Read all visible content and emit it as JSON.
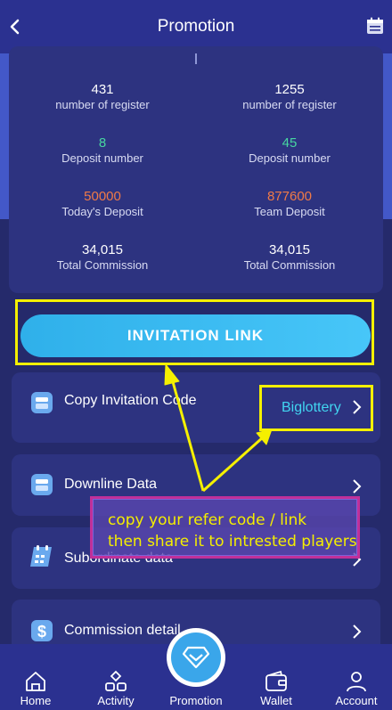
{
  "header": {
    "title": "Promotion"
  },
  "stats": {
    "left": [
      {
        "value": "431",
        "label": "number of register"
      },
      {
        "value": "8",
        "label": "Deposit number"
      },
      {
        "value": "50000",
        "label": "Today's Deposit"
      },
      {
        "value": "34,015",
        "label": "Total Commission"
      }
    ],
    "right": [
      {
        "value": "1255",
        "label": "number of register"
      },
      {
        "value": "45",
        "label": "Deposit number"
      },
      {
        "value": "877600",
        "label": "Team Deposit"
      },
      {
        "value": "34,015",
        "label": "Total Commission"
      }
    ]
  },
  "invite": {
    "label": "INVITATION LINK"
  },
  "rows": {
    "copy_code": {
      "label": "Copy Invitation Code",
      "value": "Biglottery"
    },
    "downline": {
      "label": "Downline Data"
    },
    "subordinate": {
      "label": "Subordinate data"
    },
    "commission": {
      "label": "Commission detail"
    }
  },
  "callout": {
    "line1": "copy your refer code / link",
    "line2": "then share it to intrested players"
  },
  "nav": {
    "home": "Home",
    "activity": "Activity",
    "promotion": "Promotion",
    "wallet": "Wallet",
    "account": "Account"
  },
  "colors": {
    "background": "#252a6b",
    "card": "#2d3380",
    "accent": "#41d5f0",
    "highlight": "#f5f000",
    "callout_border": "#c0309a"
  }
}
